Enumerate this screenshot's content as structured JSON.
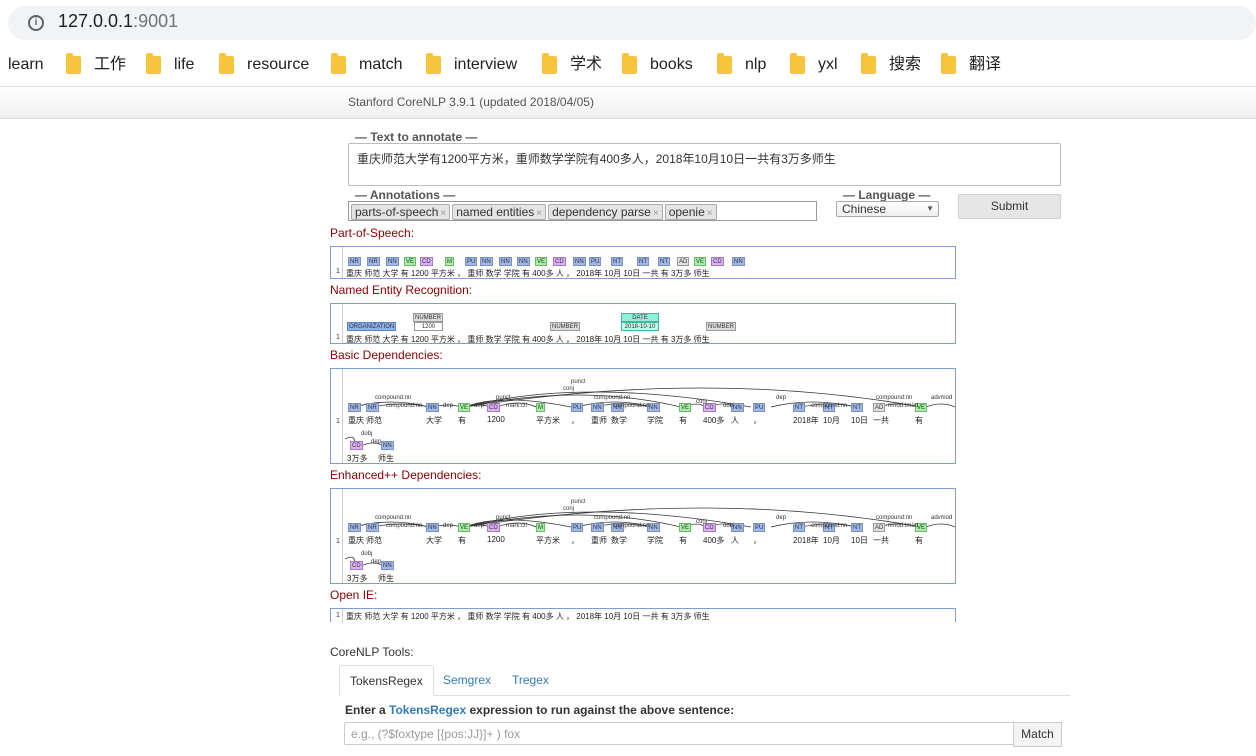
{
  "browser": {
    "url_host": "127.0.0.1",
    "url_port": ":9001"
  },
  "bookmarks": [
    "learn",
    "工作",
    "life",
    "resource",
    "match",
    "interview",
    "学术",
    "books",
    "nlp",
    "yxl",
    "搜索",
    "翻译"
  ],
  "header": {
    "title": "Stanford CoreNLP 3.9.1 (updated 2018/04/05)"
  },
  "form": {
    "text_legend": "— Text to annotate —",
    "text_value": "重庆师范大学有1200平方米，重师数学学院有400多人，2018年10月10日一共有3万多师生",
    "annotations_legend": "— Annotations —",
    "annotations": [
      "parts-of-speech",
      "named entities",
      "dependency parse",
      "openie"
    ],
    "language_legend": "— Language —",
    "language": "Chinese",
    "submit_label": "Submit"
  },
  "sections": {
    "pos": "Part-of-Speech:",
    "ner": "Named Entity Recognition:",
    "basic": "Basic Dependencies:",
    "enhanced": "Enhanced++ Dependencies:",
    "openie": "Open IE:"
  },
  "pos_tags": [
    "NR",
    "NR",
    "NN",
    "VE",
    "CD",
    "M",
    "PU",
    "NN",
    "NN",
    "NN",
    "VE",
    "CD",
    "NN",
    "PU",
    "NT",
    "NT",
    "NT",
    "AD",
    "VE",
    "CD",
    "NN"
  ],
  "pos_tokens": "重庆 师范 大学 有  1200 平方米 ，  重师 数学 学院 有  400多  人  ，  2018年 10月 10日 一共 有  3万多 师生",
  "ner": {
    "tokens": "重庆 师范 大学 有    1200    平方米 ，  重师 数学 学院 有   400多   人   ，  2018年 10月 10日 一共 有   3万多   师生",
    "org": "ORGANIZATION",
    "number1": "NUMBER",
    "number1_val": "1200",
    "number2": "NUMBER",
    "date": "DATE",
    "date_val": "2018-10-10",
    "number3": "NUMBER"
  },
  "dep": {
    "row1": [
      "重庆",
      "师范",
      "大学",
      "有",
      "1200",
      "平方米",
      "，",
      "重师",
      "数学",
      "学院",
      "有",
      "400多",
      "人",
      "，",
      "2018年",
      "10月",
      "10日",
      "一共",
      "有"
    ],
    "row2": [
      "3万多",
      "师生"
    ],
    "labels": [
      "compound:nn",
      "compound:nn",
      "dep",
      "dep",
      "mark:clf",
      "punct",
      "compound:nn",
      "compound:nn",
      "conj",
      "punct",
      "conj",
      "dobj",
      "dep",
      "compound:nn",
      "compound:nn",
      "nmod:tmod",
      "advmod",
      "dobj",
      "dep"
    ]
  },
  "openie_text": "重庆 师范 大学 有 1200 平方米 ， 重师 数学 学院 有 400多 人 ， 2018年 10月 10日 一共 有 3万多 师生",
  "tools": {
    "title": "CoreNLP Tools:",
    "tabs": [
      "TokensRegex",
      "Semgrex",
      "Tregex"
    ],
    "prompt_before": "Enter a ",
    "prompt_link": "TokensRegex",
    "prompt_after": " expression to run against the above sentence:",
    "placeholder": "e.g., (?$foxtype [{pos:JJ}]+ ) fox",
    "match_label": "Match"
  }
}
